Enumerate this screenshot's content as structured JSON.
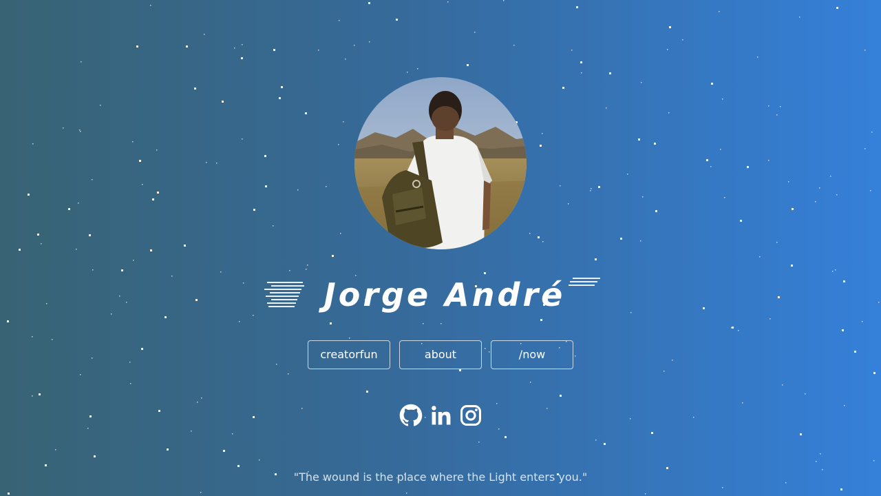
{
  "profile": {
    "name": "Jorge André",
    "avatar_alt": "Man with backpack in the desert"
  },
  "nav": [
    {
      "label": "creatorfun"
    },
    {
      "label": "about"
    },
    {
      "label": "/now"
    }
  ],
  "socials": [
    {
      "icon": "github-icon"
    },
    {
      "icon": "linkedin-icon"
    },
    {
      "icon": "instagram-icon"
    }
  ],
  "quote": "\"The wound is the place where the Light enters you.\"",
  "colors": {
    "bg_left": "#386374",
    "bg_right": "#3580d9",
    "text": "#ffffff"
  }
}
